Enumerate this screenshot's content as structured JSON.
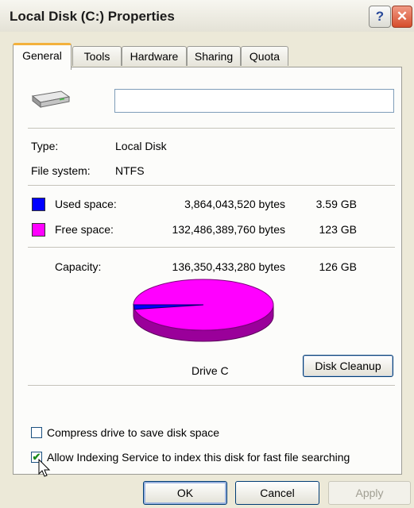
{
  "window": {
    "title": "Local Disk (C:) Properties",
    "help_label": "?",
    "close_label": "✕"
  },
  "tabs": [
    {
      "label": "General",
      "active": true
    },
    {
      "label": "Tools",
      "active": false
    },
    {
      "label": "Hardware",
      "active": false
    },
    {
      "label": "Sharing",
      "active": false
    },
    {
      "label": "Quota",
      "active": false
    }
  ],
  "general": {
    "icon": "drive-icon",
    "volume_label_value": "",
    "type_label": "Type:",
    "type_value": "Local Disk",
    "fs_label": "File system:",
    "fs_value": "NTFS",
    "used": {
      "label": "Used space:",
      "bytes": "3,864,043,520 bytes",
      "size": "3.59 GB",
      "color": "#0000ff",
      "fraction": 0.0283
    },
    "free": {
      "label": "Free space:",
      "bytes": "132,486,389,760 bytes",
      "size": "123 GB",
      "color": "#ff00ff",
      "fraction": 0.9717
    },
    "capacity": {
      "label": "Capacity:",
      "bytes": "136,350,433,280 bytes",
      "size": "126 GB"
    },
    "drive_caption": "Drive C",
    "cleanup_button": "Disk Cleanup",
    "compress": {
      "label": "Compress drive to save disk space",
      "checked": false
    },
    "indexing": {
      "label": "Allow Indexing Service to index this disk for fast file searching",
      "checked": true
    }
  },
  "buttons": {
    "ok": "OK",
    "cancel": "Cancel",
    "apply": "Apply"
  }
}
